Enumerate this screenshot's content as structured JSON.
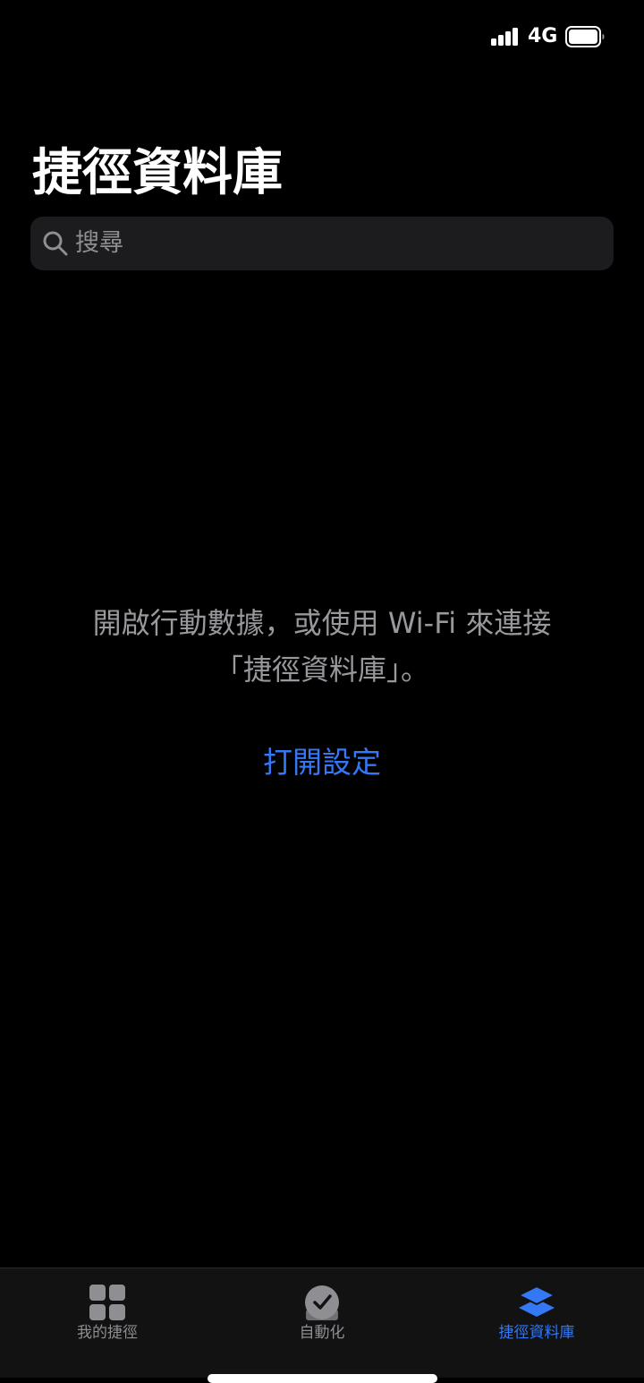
{
  "status_bar": {
    "network": "4G",
    "icons": [
      "signal-icon",
      "battery-icon"
    ]
  },
  "header": {
    "title": "捷徑資料庫"
  },
  "search": {
    "placeholder": "搜尋",
    "icon": "search-icon"
  },
  "message": {
    "line1": "開啟行動數據，或使用 Wi-Fi 來連接",
    "line2": "「捷徑資料庫」。"
  },
  "action": {
    "open_settings_label": "打開設定"
  },
  "tab_bar": {
    "tabs": [
      {
        "label": "我的捷徑",
        "icon": "grid-icon",
        "active": false
      },
      {
        "label": "自動化",
        "icon": "automation-check-icon",
        "active": false
      },
      {
        "label": "捷徑資料庫",
        "icon": "gallery-layers-icon",
        "active": true
      }
    ]
  },
  "colors": {
    "background": "#000000",
    "accent": "#3478f6",
    "secondary_text": "#98989d",
    "search_fill": "#1c1c1e",
    "tab_bar_fill": "#121212"
  }
}
